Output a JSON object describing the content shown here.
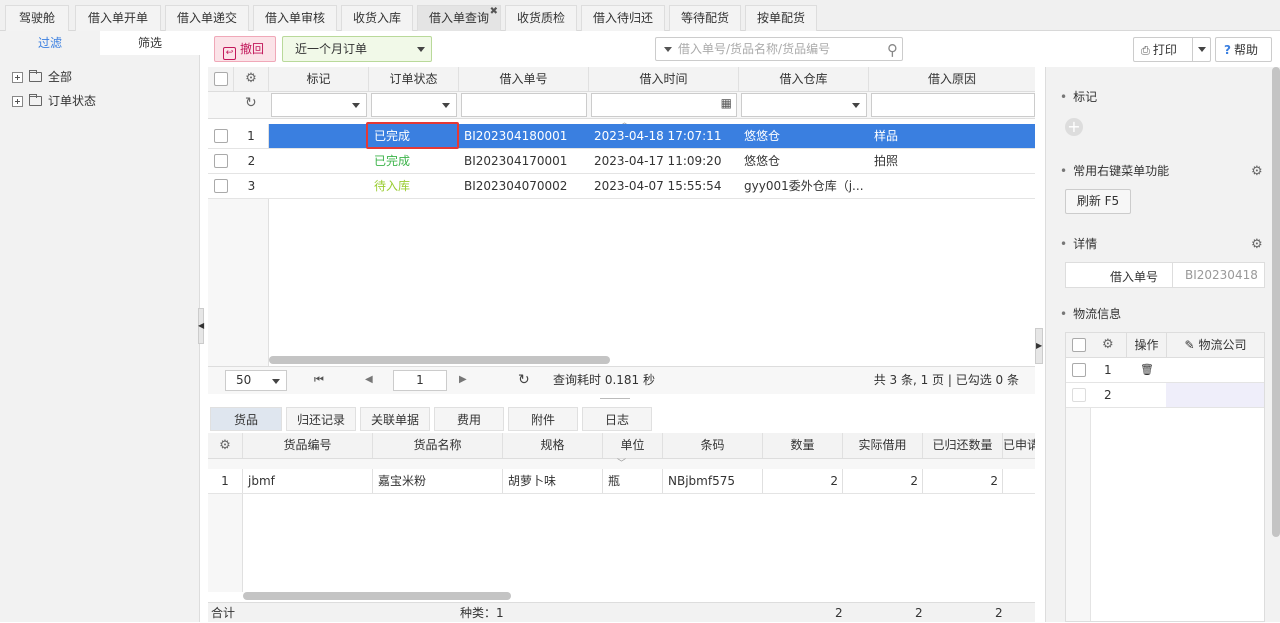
{
  "tabs": [
    {
      "label": "驾驶舱"
    },
    {
      "label": "借入单开单"
    },
    {
      "label": "借入单递交"
    },
    {
      "label": "借入单审核"
    },
    {
      "label": "收货入库"
    },
    {
      "label": "借入单查询",
      "active": true
    },
    {
      "label": "收货质检"
    },
    {
      "label": "借入待归还"
    },
    {
      "label": "等待配货"
    },
    {
      "label": "按单配货"
    }
  ],
  "left_panel": {
    "tab_filter": "过滤",
    "tab_screen": "筛选",
    "tree": [
      {
        "label": "全部"
      },
      {
        "label": "订单状态"
      }
    ]
  },
  "toolbar": {
    "revoke": "撤回",
    "period": "近一个月订单",
    "search_placeholder": "借入单号/货品名称/货品编号",
    "print": "打印",
    "help": "帮助"
  },
  "grid": {
    "headers": {
      "mark": "标记",
      "status": "订单状态",
      "order_no": "借入单号",
      "time": "借入时间",
      "warehouse": "借入仓库",
      "reason": "借入原因"
    },
    "rows": [
      {
        "idx": "1",
        "status": "已完成",
        "order_no": "BI202304180001",
        "time": "2023-04-18 17:07:11",
        "warehouse": "悠悠仓",
        "reason": "样品",
        "status_color": "#ffffff"
      },
      {
        "idx": "2",
        "status": "已完成",
        "order_no": "BI202304170001",
        "time": "2023-04-17 11:09:20",
        "warehouse": "悠悠仓",
        "reason": "拍照",
        "status_color": "#3cb34a"
      },
      {
        "idx": "3",
        "status": "待入库",
        "order_no": "BI202304070002",
        "time": "2023-04-07 15:55:54",
        "warehouse": "gyy001委外仓库（j...",
        "reason": "",
        "status_color": "#9acd32"
      }
    ],
    "page_size": "50",
    "page": "1",
    "query_time": "查询耗时 0.181 秒",
    "summary": "共 3 条, 1 页 | 已勾选 0 条"
  },
  "bottom_tabs": [
    {
      "label": "货品",
      "active": true
    },
    {
      "label": "归还记录"
    },
    {
      "label": "关联单据"
    },
    {
      "label": "费用"
    },
    {
      "label": "附件"
    },
    {
      "label": "日志"
    }
  ],
  "detail_grid": {
    "headers": {
      "code": "货品编号",
      "name": "货品名称",
      "spec": "规格",
      "unit": "单位",
      "barcode": "条码",
      "qty": "数量",
      "actual": "实际借用",
      "returned": "已归还数量",
      "applied": "已申请"
    },
    "rows": [
      {
        "idx": "1",
        "code": "jbmf",
        "name": "嘉宝米粉",
        "spec": "胡萝卜味",
        "unit": "瓶",
        "barcode": "NBjbmf575",
        "qty": "2",
        "actual": "2",
        "returned": "2"
      }
    ],
    "footer": {
      "total": "合计",
      "kinds": "种类：1",
      "qty": "2",
      "actual": "2",
      "returned": "2"
    }
  },
  "right_panel": {
    "mark_title": "标记",
    "menu_title": "常用右键菜单功能",
    "refresh": "刷新 F5",
    "detail_title": "详情",
    "detail_label": "借入单号",
    "detail_value": "BI20230418",
    "logistics_title": "物流信息",
    "log_headers": {
      "op": "操作",
      "company": "物流公司"
    },
    "log_rows": [
      "1",
      "2"
    ]
  },
  "colors": {
    "accent": "#3a7fe0",
    "highlight": "#e53935",
    "revoke_bg": "#fbe3e8"
  }
}
